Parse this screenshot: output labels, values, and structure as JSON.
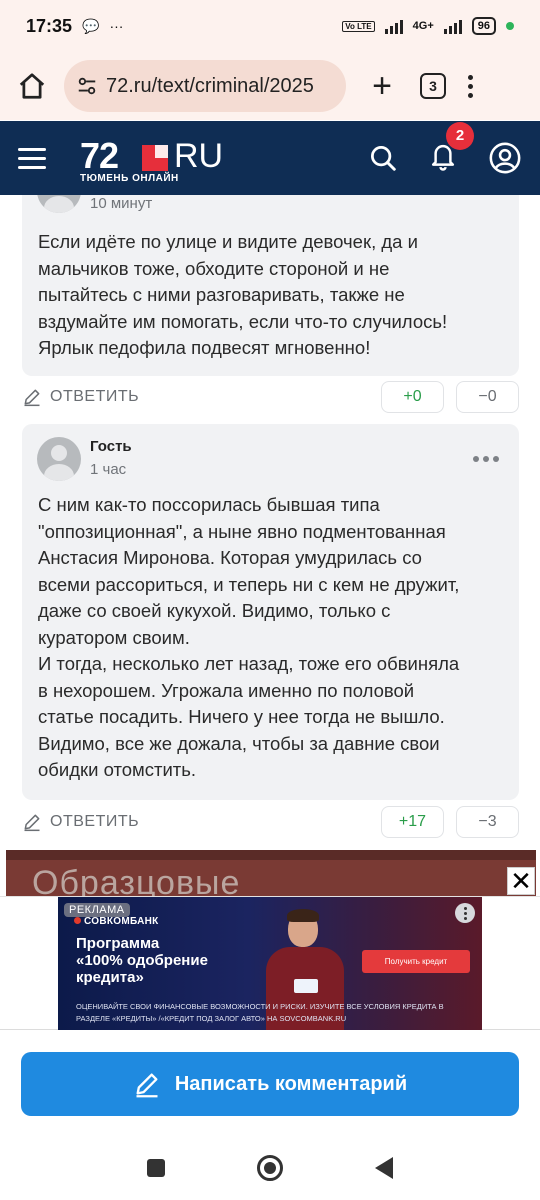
{
  "status_bar": {
    "time": "17:35",
    "network_label": "Vo LTE",
    "net_type": "4G+",
    "battery": "96"
  },
  "browser": {
    "url": "72.ru/text/criminal/2025",
    "tab_count": "3"
  },
  "site_header": {
    "logo_number": "72",
    "logo_suffix": "RU",
    "logo_subtitle": "ТЮМЕНЬ ОНЛАЙН",
    "notification_count": "2"
  },
  "comments": [
    {
      "time": "10 минут",
      "text": "Если идёте по улице и видите девочек, да и\nмальчиков тоже, обходите стороной и не\nпытайтесь с ними разговаривать, также не\nвздумайте им помогать, если что-то случилось!\nЯрлык педофила подвесят мгновенно!",
      "reply_label": "ОТВЕТИТЬ",
      "upvotes": "+0",
      "downvotes": "−0"
    },
    {
      "author": "Гость",
      "time": "1 час",
      "text": "С ним как-то поссорилась бывшая типа\n\"оппозиционная\", а ныне явно подментованная\nАнстасия Миронова. Которая умудрилась со\nвсеми рассориться, и теперь ни с кем не дружит,\nдаже со своей кукухой. Видимо, только с\nкуратором своим.\nИ тогда, несколько лет назад, тоже его обвиняла\nв нехорошем. Угрожала именно по половой\nстатье посадить. Ничего у нее тогда не вышло.\nВидимо, все же дожала, чтобы за давние свои\nобидки отомстить.",
      "reply_label": "ОТВЕТИТЬ",
      "upvotes": "+17",
      "downvotes": "−3"
    }
  ],
  "ad": {
    "background_text": "Образцовые",
    "close_symbol": "✕",
    "tag": "РЕКЛАМА",
    "bank": "СОВКОМБАНК",
    "title": "Программа\n«100% одобрение\nкредита»",
    "button": "Получить кредит",
    "fine_print": "ОЦЕНИВАЙТЕ СВОИ ФИНАНСОВЫЕ ВОЗМОЖНОСТИ И РИСКИ. ИЗУЧИТЕ ВСЕ УСЛОВИЯ КРЕДИТА В РАЗДЕЛЕ «КРЕДИТЫ» /«КРЕДИТ ПОД ЗАЛОГ АВТО» НА SOVCOMBANK.RU"
  },
  "write_comment": {
    "label": "Написать комментарий"
  },
  "colors": {
    "header_bg": "#0f2d54",
    "accent_red": "#e62f3b",
    "button_blue": "#1f8ae0",
    "vote_up": "#2a9d4a"
  }
}
